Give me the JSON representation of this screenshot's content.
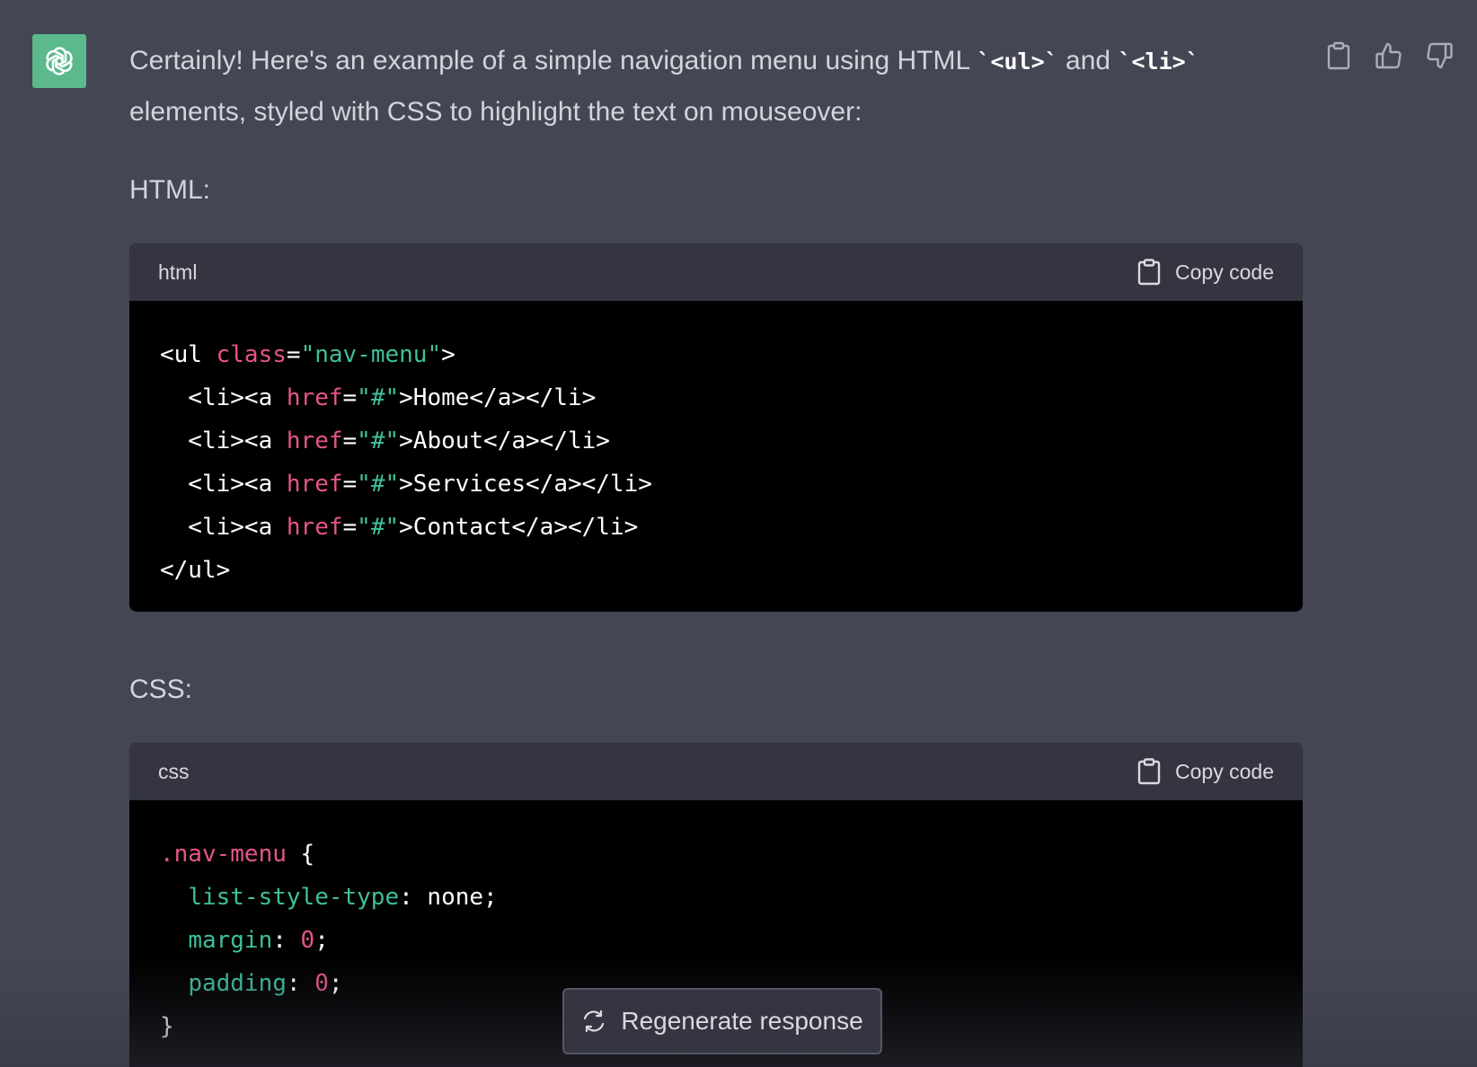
{
  "message": {
    "intro_before_ul": "Certainly! Here's an example of a simple navigation menu using HTML ",
    "code_ul": "`<ul>`",
    "intro_and": " and ",
    "code_li": "`<li>`",
    "intro_after": " elements, styled with CSS to highlight the text on mouseover:",
    "html_label": "HTML:",
    "css_label": "CSS:"
  },
  "html_block": {
    "lang": "html",
    "copy_label": "Copy code",
    "lines": [
      {
        "parts": [
          [
            "",
            "<ul "
          ],
          [
            "attr",
            "class"
          ],
          [
            "",
            "="
          ],
          [
            "str",
            "\"nav-menu\""
          ],
          [
            "",
            ">"
          ]
        ]
      },
      {
        "parts": [
          [
            "",
            "  <li><a "
          ],
          [
            "attr",
            "href"
          ],
          [
            "",
            "="
          ],
          [
            "str",
            "\"#\""
          ],
          [
            "",
            ">Home</a></li>"
          ]
        ]
      },
      {
        "parts": [
          [
            "",
            "  <li><a "
          ],
          [
            "attr",
            "href"
          ],
          [
            "",
            "="
          ],
          [
            "str",
            "\"#\""
          ],
          [
            "",
            ">About</a></li>"
          ]
        ]
      },
      {
        "parts": [
          [
            "",
            "  <li><a "
          ],
          [
            "attr",
            "href"
          ],
          [
            "",
            "="
          ],
          [
            "str",
            "\"#\""
          ],
          [
            "",
            ">Services</a></li>"
          ]
        ]
      },
      {
        "parts": [
          [
            "",
            "  <li><a "
          ],
          [
            "attr",
            "href"
          ],
          [
            "",
            "="
          ],
          [
            "str",
            "\"#\""
          ],
          [
            "",
            ">Contact</a></li>"
          ]
        ]
      },
      {
        "parts": [
          [
            "",
            "</ul>"
          ]
        ]
      }
    ]
  },
  "css_block": {
    "lang": "css",
    "copy_label": "Copy code",
    "lines": [
      {
        "parts": [
          [
            "sel",
            ".nav-menu"
          ],
          [
            "",
            " {"
          ]
        ]
      },
      {
        "parts": [
          [
            "",
            "  "
          ],
          [
            "prop",
            "list-style-type"
          ],
          [
            "",
            ": none;"
          ]
        ]
      },
      {
        "parts": [
          [
            "",
            "  "
          ],
          [
            "prop",
            "margin"
          ],
          [
            "",
            ": "
          ],
          [
            "num",
            "0"
          ],
          [
            "",
            ";"
          ]
        ]
      },
      {
        "parts": [
          [
            "",
            "  "
          ],
          [
            "prop",
            "padding"
          ],
          [
            "",
            ": "
          ],
          [
            "num",
            "0"
          ],
          [
            "",
            ";"
          ]
        ]
      },
      {
        "parts": [
          [
            "",
            "}"
          ]
        ]
      }
    ]
  },
  "regenerate_label": "Regenerate response",
  "icons": {
    "avatar": "openai-logo-icon",
    "copy_message": "clipboard-icon",
    "thumbs_up": "thumbs-up-icon",
    "thumbs_down": "thumbs-down-icon",
    "copy_code": "clipboard-icon",
    "regenerate": "refresh-icon"
  },
  "colors": {
    "background": "#444654",
    "code_header": "#343541",
    "code_body": "#000000",
    "attr": "#e5558b",
    "string": "#3fbf9b",
    "avatar": "#5bb98c"
  }
}
